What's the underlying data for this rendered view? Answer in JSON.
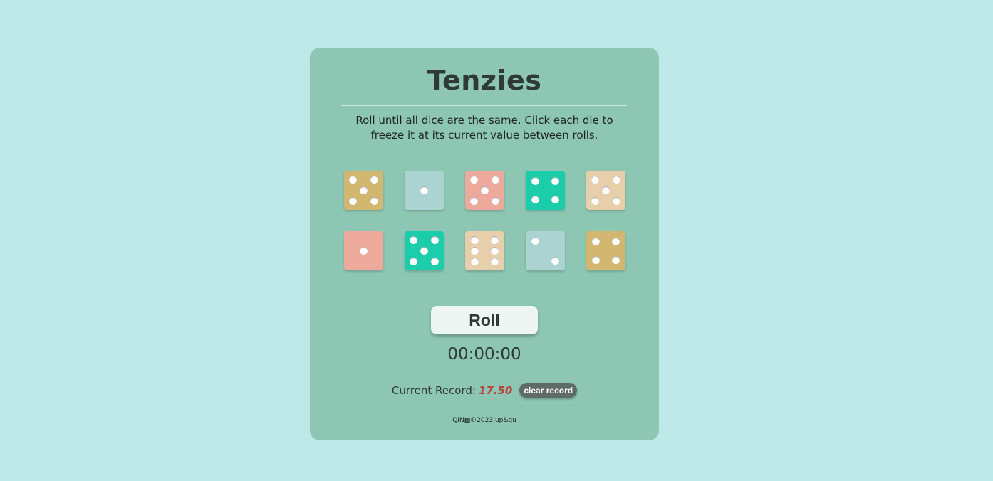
{
  "app": {
    "title": "Tenzies",
    "instructions": "Roll until all dice are the same. Click each die to freeze it at its current value between rolls."
  },
  "colors": {
    "page_background": "#bee7e8",
    "card_background": "#8dc7b4",
    "die_colors": [
      "#d1b76f",
      "#abd3d1",
      "#eca99c",
      "#1ccdac",
      "#e8cfab"
    ]
  },
  "dice": [
    {
      "value": 5,
      "color": "#d1b76f"
    },
    {
      "value": 1,
      "color": "#abd3d1"
    },
    {
      "value": 5,
      "color": "#eca99c"
    },
    {
      "value": 4,
      "color": "#1ccdac"
    },
    {
      "value": 5,
      "color": "#e8cfab"
    },
    {
      "value": 1,
      "color": "#eca99c"
    },
    {
      "value": 5,
      "color": "#1ccdac"
    },
    {
      "value": 6,
      "color": "#e8cfab"
    },
    {
      "value": 2,
      "color": "#abd3d1"
    },
    {
      "value": 4,
      "color": "#d1b76f"
    }
  ],
  "controls": {
    "roll_label": "Roll",
    "clear_record_label": "clear record"
  },
  "timer": {
    "display": "00:00:00"
  },
  "record": {
    "label": "Current Record:",
    "value": "17.50"
  },
  "footer": {
    "text": "QIN▩©2023 up&qu"
  }
}
